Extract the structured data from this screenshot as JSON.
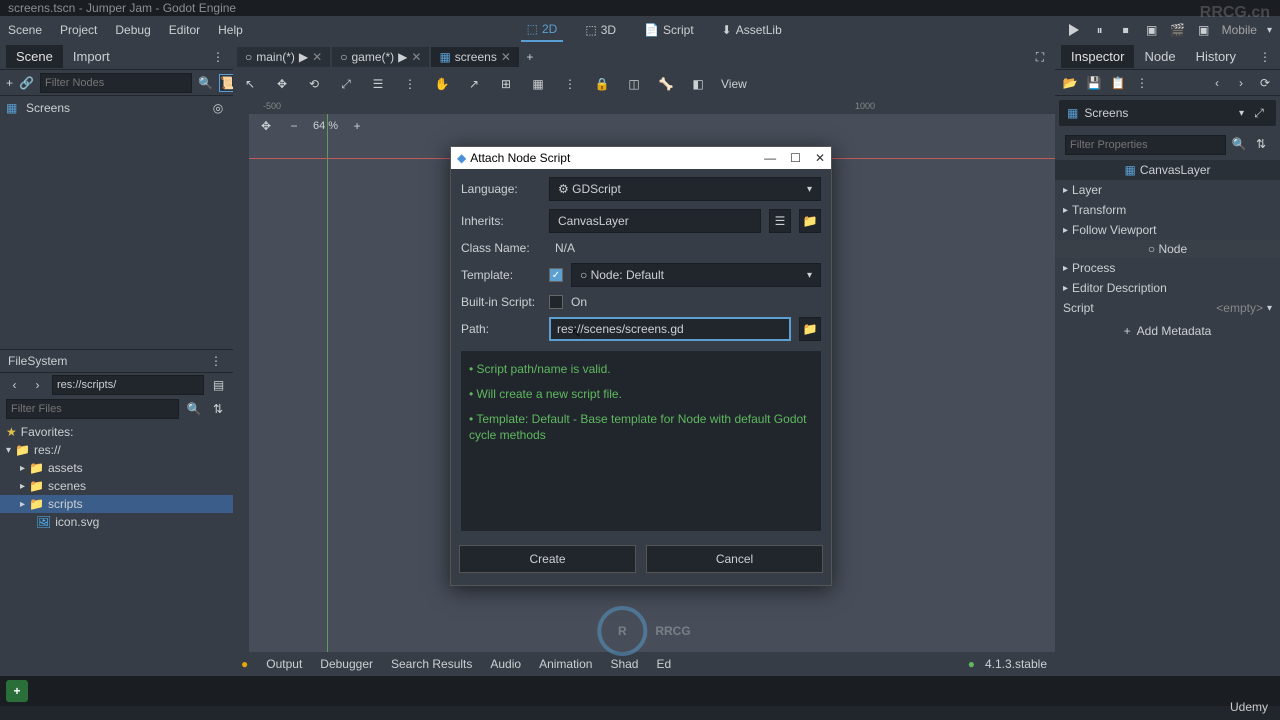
{
  "titlebar": "screens.tscn - Jumper Jam - Godot Engine",
  "menubar": {
    "scene": "Scene",
    "project": "Project",
    "debug": "Debug",
    "editor": "Editor",
    "help": "Help"
  },
  "workspace": {
    "d2": "2D",
    "d3": "3D",
    "script": "Script",
    "assetlib": "AssetLib",
    "mobile": "Mobile"
  },
  "scene_panel": {
    "tab_scene": "Scene",
    "tab_import": "Import",
    "filter_placeholder": "Filter Nodes",
    "root_name": "Screens"
  },
  "filesystem": {
    "title": "FileSystem",
    "path": "res://scripts/",
    "filter_placeholder": "Filter Files",
    "favorites": "Favorites:",
    "root": "res://",
    "folders": [
      "assets",
      "scenes",
      "scripts"
    ],
    "files": [
      "icon.svg"
    ]
  },
  "tabs": [
    {
      "name": "main(*)",
      "active": false
    },
    {
      "name": "game(*)",
      "active": false
    },
    {
      "name": "screens",
      "active": true
    }
  ],
  "ruler": {
    "m500": "-500",
    "p1000": "1000"
  },
  "viewport_toolbar": {
    "view": "View"
  },
  "zoom": "64 %",
  "bottom": {
    "output": "Output",
    "debugger": "Debugger",
    "search": "Search Results",
    "audio": "Audio",
    "animation": "Animation",
    "shad": "Shad",
    "ed": "Ed",
    "version": "4.1.3.stable"
  },
  "inspector": {
    "tab_inspector": "Inspector",
    "tab_node": "Node",
    "tab_history": "History",
    "node_name": "Screens",
    "filter_placeholder": "Filter Properties",
    "class": "CanvasLayer",
    "props": [
      "Layer",
      "Transform",
      "Follow Viewport"
    ],
    "node_h": "Node",
    "more": [
      "Process",
      "Editor Description"
    ],
    "script_label": "Script",
    "script_value": "<empty>",
    "add_metadata": "Add Metadata"
  },
  "dialog": {
    "title": "Attach Node Script",
    "labels": {
      "language": "Language:",
      "inherits": "Inherits:",
      "class_name": "Class Name:",
      "template": "Template:",
      "builtin": "Built-in Script:",
      "path": "Path:"
    },
    "language_val": "GDScript",
    "inherits_val": "CanvasLayer",
    "class_name_val": "N/A",
    "template_val": "Node: Default",
    "builtin_val": "On",
    "path_val": "res://scenes/screens.gd",
    "status1": "•  Script path/name is valid.",
    "status2": "•  Will create a new script file.",
    "status3": "•  Template: Default - Base template for Node with default Godot cycle methods",
    "create": "Create",
    "cancel": "Cancel"
  },
  "watermark": {
    "main": "RRCG",
    "top": "RRCG.cn",
    "udemy": "Udemy"
  }
}
